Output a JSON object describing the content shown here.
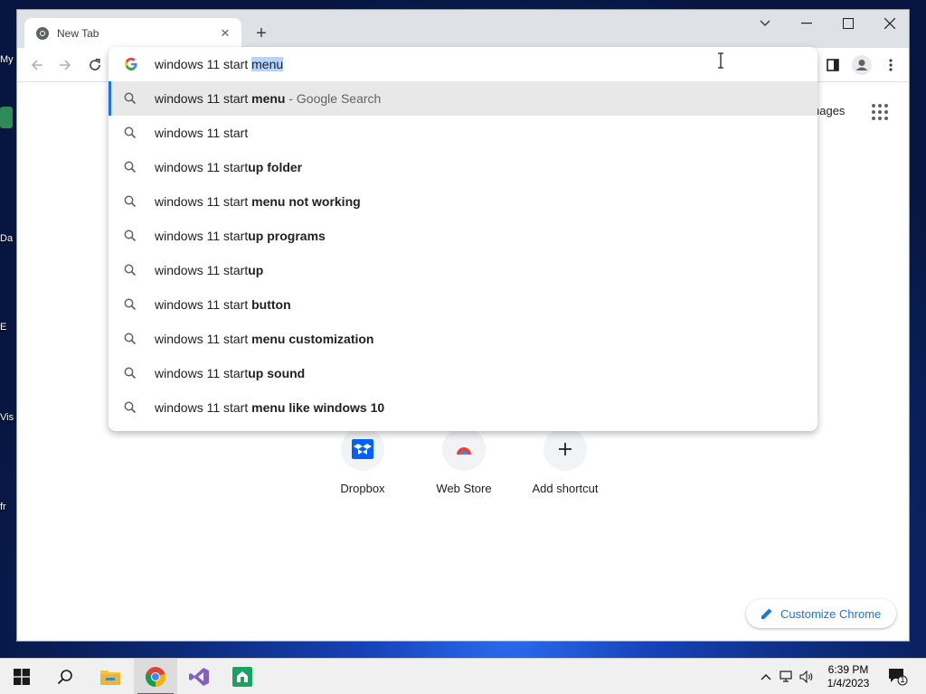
{
  "desktop": {
    "icon_labels": [
      "My",
      "Da",
      "E",
      "Vis",
      "fr"
    ]
  },
  "browser": {
    "tab": {
      "title": "New Tab"
    },
    "omnibox": {
      "typed_text": "windows 11 start ",
      "selected_autocomplete": "menu",
      "suggestions": [
        {
          "plain": "windows 11 start ",
          "bold": "menu",
          "source": " - Google Search"
        },
        {
          "plain": "windows 11 start",
          "bold": "",
          "source": ""
        },
        {
          "plain": "windows 11 start",
          "bold": "up folder",
          "source": ""
        },
        {
          "plain": "windows 11 start ",
          "bold": "menu not working",
          "source": ""
        },
        {
          "plain": "windows 11 start",
          "bold": "up programs",
          "source": ""
        },
        {
          "plain": "windows 11 start",
          "bold": "up",
          "source": ""
        },
        {
          "plain": "windows 11 start ",
          "bold": "button",
          "source": ""
        },
        {
          "plain": "windows 11 start ",
          "bold": "menu customization",
          "source": ""
        },
        {
          "plain": "windows 11 start",
          "bold": "up sound",
          "source": ""
        },
        {
          "plain": "windows 11 start ",
          "bold": "menu like windows 10",
          "source": ""
        }
      ]
    },
    "ntp": {
      "images_link": "nages",
      "shortcuts": [
        {
          "label": "Dropbox"
        },
        {
          "label": "Web Store"
        },
        {
          "label": "Add shortcut"
        }
      ],
      "customize_label": "Customize Chrome"
    }
  },
  "taskbar": {
    "clock_time": "6:39 PM",
    "clock_date": "1/4/2023",
    "notification_count": "1"
  },
  "colors": {
    "accent": "#1a73e8",
    "tab_strip": "#dee1e6",
    "selection": "#b6d4fb"
  }
}
